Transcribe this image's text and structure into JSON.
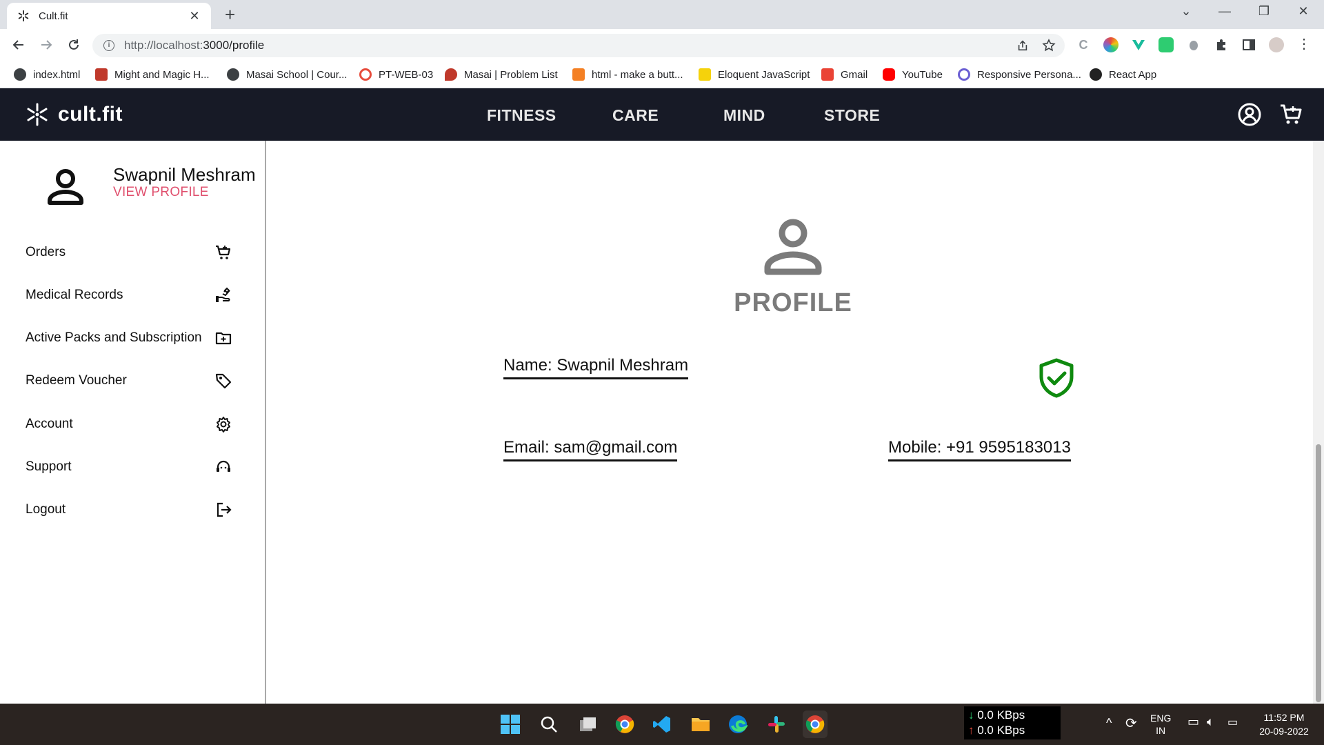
{
  "browser": {
    "tab_title": "Cult.fit",
    "url_host": "http://localhost:",
    "url_path": "3000/profile",
    "bookmarks": [
      {
        "label": "index.html",
        "icon": "globe-icon",
        "color": "#3c4043"
      },
      {
        "label": "Might and Magic H...",
        "icon": "game-icon",
        "color": "#c0392b"
      },
      {
        "label": "Masai School | Cour...",
        "icon": "globe-icon",
        "color": "#3c4043"
      },
      {
        "label": "PT-WEB-03",
        "icon": "wheel-icon",
        "color": "#e74c3c"
      },
      {
        "label": "Masai | Problem List",
        "icon": "pin-icon",
        "color": "#c0392b"
      },
      {
        "label": "html - make a butt...",
        "icon": "stack-icon",
        "color": "#f48024"
      },
      {
        "label": "Eloquent JavaScript",
        "icon": "ejs-icon",
        "color": "#f5d20b"
      },
      {
        "label": "Gmail",
        "icon": "gmail-icon",
        "color": "#ea4335"
      },
      {
        "label": "YouTube",
        "icon": "youtube-icon",
        "color": "#ff0000"
      },
      {
        "label": "Responsive Persona...",
        "icon": "react-icon",
        "color": "#6b5fd3"
      },
      {
        "label": "React App",
        "icon": "cultfit-icon",
        "color": "#222222"
      }
    ]
  },
  "header": {
    "logo_text": "cult.fit",
    "nav": [
      "FITNESS",
      "CARE",
      "MIND",
      "STORE"
    ]
  },
  "sidebar": {
    "user_name": "Swapnil Meshram",
    "view_profile": "VIEW PROFILE",
    "items": [
      {
        "label": "Orders",
        "icon": "cart-icon"
      },
      {
        "label": "Medical Records",
        "icon": "medical-hand-icon"
      },
      {
        "label": "Active Packs and Subscription",
        "icon": "folder-add-icon"
      },
      {
        "label": "Redeem Voucher",
        "icon": "tag-icon"
      },
      {
        "label": "Account",
        "icon": "gear-icon"
      },
      {
        "label": "Support",
        "icon": "support-icon"
      },
      {
        "label": "Logout",
        "icon": "logout-icon"
      }
    ]
  },
  "profile": {
    "title": "PROFILE",
    "name": "Name: Swapnil Meshram",
    "email": "Email: sam@gmail.com",
    "mobile": "Mobile: +91 9595183013"
  },
  "taskbar": {
    "download": "0.0 KBps",
    "upload": "0.0 KBps",
    "lang": "ENG",
    "region": "IN",
    "time": "11:52 PM",
    "date": "20-09-2022"
  },
  "colors": {
    "header_bg": "#171a26",
    "accent_pink": "#e0506e",
    "verified_green": "#0f8a0f",
    "profile_gray": "#7b7b7b"
  }
}
